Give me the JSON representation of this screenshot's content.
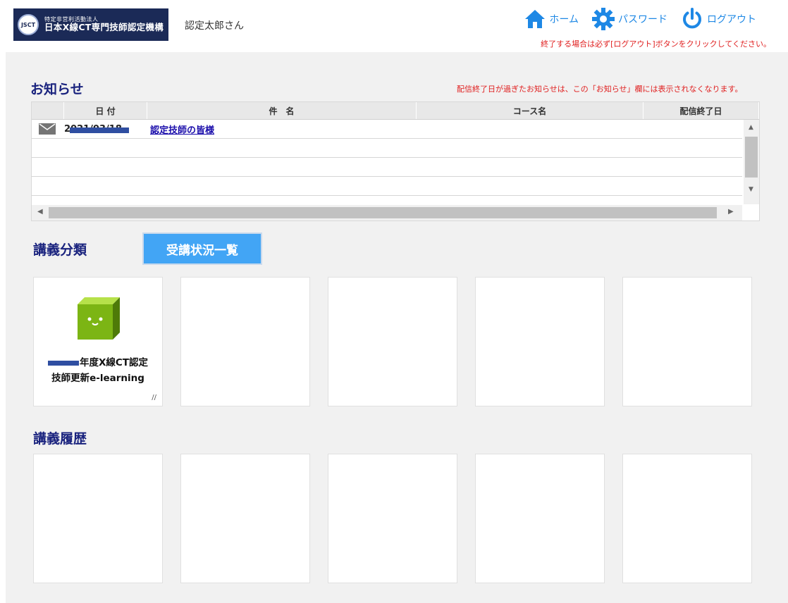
{
  "header": {
    "org_sub": "特定非営利活動法人",
    "org_name": "日本X線CT専門技師認定機構",
    "logo_badge": "JSCT",
    "username": "認定太郎さん",
    "nav": {
      "home": "ホーム",
      "password": "パスワード",
      "logout": "ログアウト"
    },
    "logout_note": "終了する場合は必ず[ログアウト]ボタンをクリックしてください。"
  },
  "notice": {
    "title": "お知らせ",
    "note": "配信終了日が過ぎたお知らせは、この「お知らせ」欄には表示されなくなります。",
    "columns": [
      "日 付",
      "件　名",
      "コース名",
      "配信終了日"
    ],
    "rows": [
      {
        "icon": "mail-icon",
        "date": "2021/03/18",
        "subject": "認定技師の皆様",
        "course": "",
        "end_date": ""
      }
    ]
  },
  "lectures": {
    "title": "講義分類",
    "status_button": "受講状況一覧",
    "course": {
      "title_line1": "年度X線CT認定",
      "title_line2": "技師更新e-learning"
    }
  },
  "history": {
    "title": "講義履歴"
  },
  "colors": {
    "accent": "#42a5f5",
    "heading": "#1a237e",
    "warning": "#e02020",
    "nav": "#1e88e5",
    "logo_bg": "#1b2a57"
  }
}
